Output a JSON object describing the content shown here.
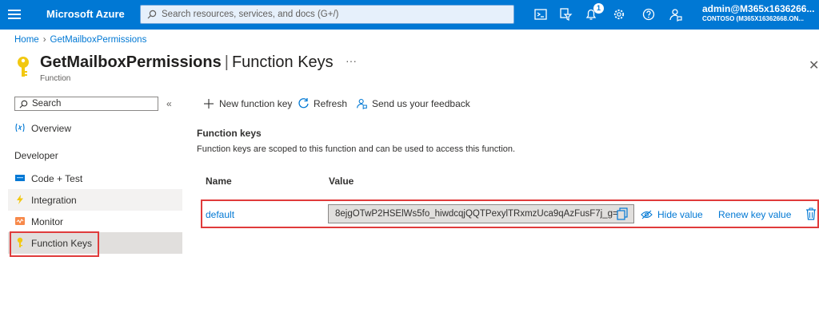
{
  "topbar": {
    "brand": "Microsoft Azure",
    "search_placeholder": "Search resources, services, and docs (G+/)",
    "notification_count": "1",
    "account_email": "admin@M365x1636266...",
    "account_tenant": "CONTOSO (M365X16362668.ON...",
    "color": "#0078d4"
  },
  "breadcrumb": {
    "home": "Home",
    "current": "GetMailboxPermissions"
  },
  "header": {
    "resource": "GetMailboxPermissions",
    "separator": "|",
    "page": "Function Keys",
    "more": "···",
    "subtitle": "Function"
  },
  "sidebar": {
    "search_placeholder": "Search",
    "collapse": "«",
    "overview": "Overview",
    "section": "Developer",
    "items": [
      {
        "label": "Code + Test"
      },
      {
        "label": "Integration"
      },
      {
        "label": "Monitor"
      },
      {
        "label": "Function Keys"
      }
    ]
  },
  "toolbar": {
    "new_key": "New function key",
    "refresh": "Refresh",
    "feedback": "Send us your feedback"
  },
  "content": {
    "title": "Function keys",
    "description": "Function keys are scoped to this function and can be used to access this function.",
    "col_name": "Name",
    "col_value": "Value",
    "rows": [
      {
        "name": "default",
        "value": "8ejgOTwP2HSElWs5fo_hiwdcqjQQTPexylTRxmzUca9qAzFusF7j_g==",
        "hide_label": "Hide value",
        "renew_label": "Renew key value"
      }
    ]
  },
  "colors": {
    "accent": "#0078d4",
    "highlight": "#e03b3b",
    "key_icon": "#f2c811"
  }
}
